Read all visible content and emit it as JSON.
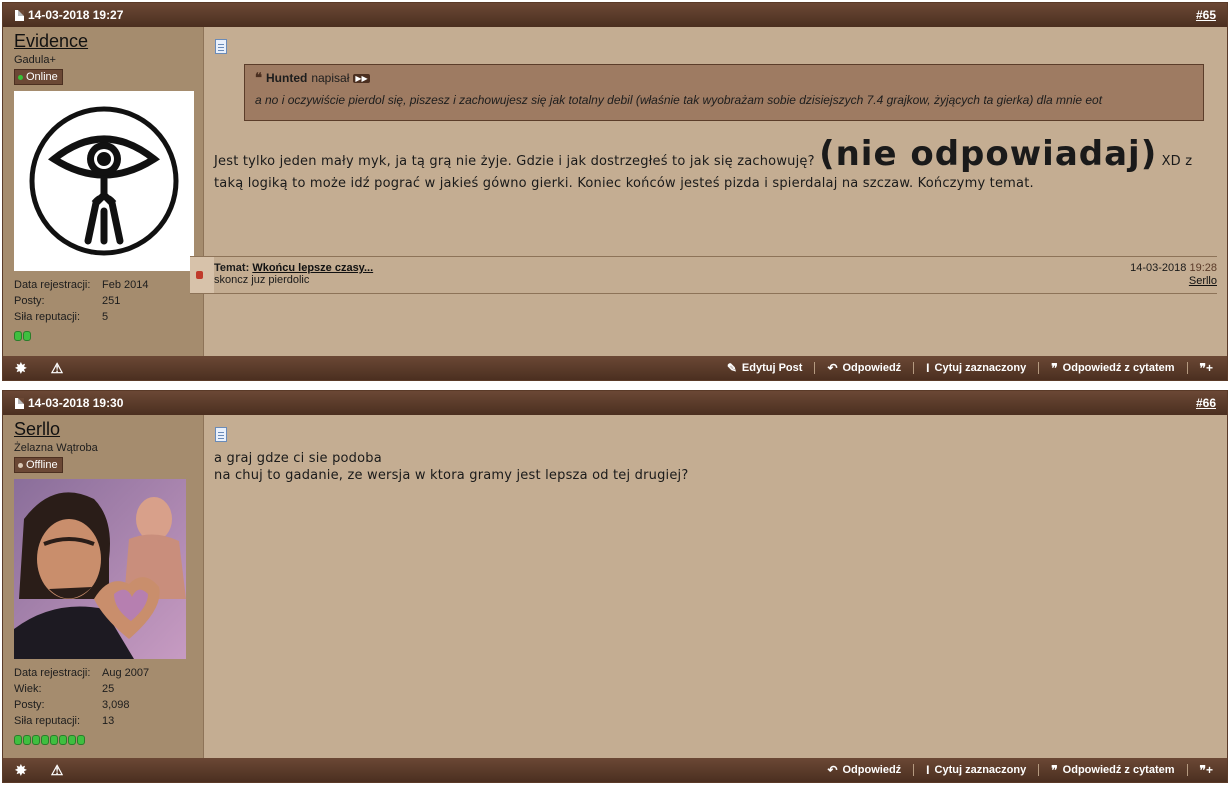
{
  "posts": [
    {
      "date": "14-03-2018 19:27",
      "number": "#65",
      "user": {
        "name": "Evidence",
        "title": "Gadula+",
        "status": "Online",
        "status_color": "#36c236",
        "reg_label": "Data rejestracji:",
        "reg_value": "Feb 2014",
        "posts_label": "Posty:",
        "posts_value": "251",
        "rep_label": "Siła reputacji:",
        "rep_value": "5",
        "rep_pips": 2
      },
      "quote": {
        "author": "Hunted",
        "wrote": "napisał",
        "text": "a no i oczywiście pierdol się, piszesz i zachowujesz się jak totalny debil (właśnie tak wyobrażam sobie dzisiejszych 7.4 grajkow, żyjących ta gierka) dla mnie eot"
      },
      "message_before": "Jest tylko jeden mały myk, ja tą grą nie żyje. Gdzie i jak dostrzegłeś to jak się zachowuję?",
      "message_big": "(nie odpowiadaj)",
      "message_after": "XD z taką logiką to może idź pograć w jakieś gówno gierki. Koniec końców jesteś pizda i spierdalaj na szczaw. Kończymy temat.",
      "similar": {
        "label": "Temat:",
        "title": "Wkońcu lepsze czasy...",
        "snippet": "skoncz juz pierdolic",
        "date": "14-03-2018",
        "time": "19:28",
        "author": "Serllo"
      },
      "footer": {
        "edit": "Edytuj Post",
        "reply": "Odpowiedź",
        "quote_sel": "Cytuj zaznaczony",
        "reply_quote": "Odpowiedź z cytatem"
      }
    },
    {
      "date": "14-03-2018 19:30",
      "number": "#66",
      "user": {
        "name": "Serllo",
        "title": "Żelazna Wątroba",
        "status": "Offline",
        "status_color": "#d9c7b4",
        "reg_label": "Data rejestracji:",
        "reg_value": "Aug 2007",
        "age_label": "Wiek:",
        "age_value": "25",
        "posts_label": "Posty:",
        "posts_value": "3,098",
        "rep_label": "Siła reputacji:",
        "rep_value": "13",
        "rep_pips": 8
      },
      "message_line1": "a graj gdze ci sie podoba",
      "message_line2": "na chuj to gadanie, ze wersja w ktora gramy jest lepsza od tej drugiej?",
      "footer": {
        "reply": "Odpowiedź",
        "quote_sel": "Cytuj zaznaczony",
        "reply_quote": "Odpowiedź z cytatem"
      }
    }
  ],
  "icons": {
    "star": "star-icon",
    "warn": "warning-icon",
    "pencil": "pencil-icon",
    "reply": "reply-arrow-icon",
    "cursor": "text-cursor-icon",
    "quote": "quote-bubble-icon",
    "multi": "multiquote-icon"
  }
}
